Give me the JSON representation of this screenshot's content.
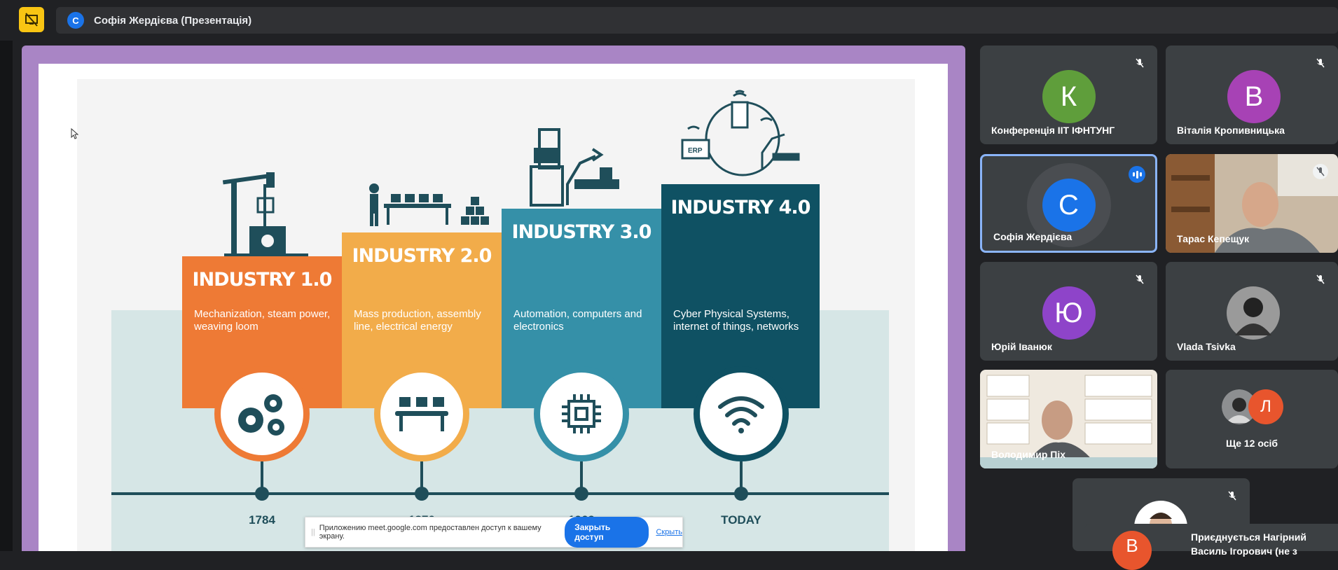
{
  "title_bar": {
    "avatar_letter": "С",
    "title": "Софія Жердієва (Презентація)"
  },
  "slide": {
    "stages": [
      {
        "heading": "INDUSTRY 1.0",
        "description": "Mechanization, steam power, weaving loom",
        "year": "1784",
        "color": "#ee7a35"
      },
      {
        "heading": "INDUSTRY 2.0",
        "description": "Mass production, assembly line, electrical energy",
        "year": "1870",
        "color": "#f2ac4a"
      },
      {
        "heading": "INDUSTRY 3.0",
        "description": "Automation, computers and electronics",
        "year": "1969",
        "color": "#3590a8"
      },
      {
        "heading": "INDUSTRY 4.0",
        "description": "Cyber Physical Systems, internet of things, networks",
        "year": "TODAY",
        "color": "#0f5163"
      }
    ],
    "erp_label": "ERP"
  },
  "share_banner": {
    "message": "Приложению meet.google.com предоставлен доступ к вашему экрану.",
    "stop_label": "Закрыть доступ",
    "hide_label": "Скрыть"
  },
  "participants": [
    {
      "name": "Конференція ІІТ ІФНТУНГ",
      "letter": "К",
      "color": "#5f9e3b",
      "muted": true
    },
    {
      "name": "Віталія Кропивницька",
      "letter": "В",
      "color": "#a742b5",
      "muted": true
    },
    {
      "name": "Софія Жердієва",
      "letter": "С",
      "color": "#1a73e8",
      "speaking": true
    },
    {
      "name": "Тарас Кепещук",
      "muted": true,
      "video": true
    },
    {
      "name": "Юрій Іванюк",
      "letter": "Ю",
      "color": "#8e44c9",
      "muted": true
    },
    {
      "name": "Vlada Tsivka",
      "muted": true
    },
    {
      "name": "Володимир Піх",
      "muted": true,
      "video": true
    },
    {
      "name": "Ще 12 осіб",
      "letter": "Л",
      "color": "#e8552d"
    }
  ],
  "join_notice": {
    "letter": "В",
    "color": "#e8552d",
    "line1": "Приєднується Нагірний",
    "line2": "Василь Ігорович (не з"
  }
}
